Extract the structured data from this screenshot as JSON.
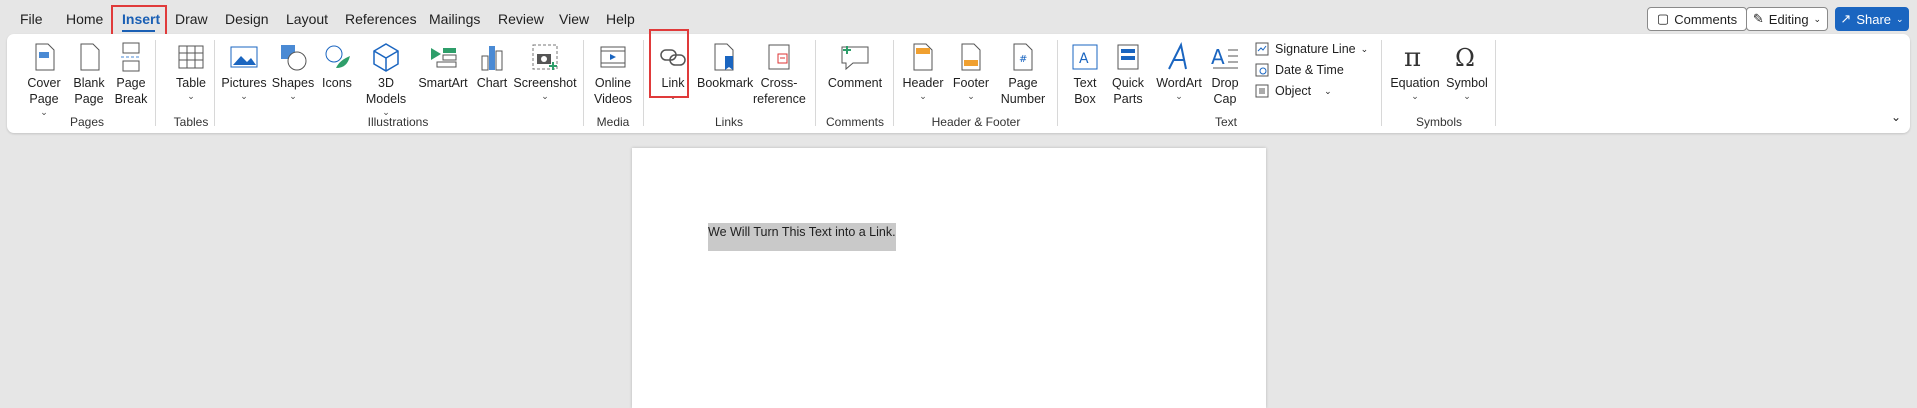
{
  "tabs": [
    {
      "label": "File"
    },
    {
      "label": "Home"
    },
    {
      "label": "Insert",
      "active": true
    },
    {
      "label": "Draw"
    },
    {
      "label": "Design"
    },
    {
      "label": "Layout"
    },
    {
      "label": "References"
    },
    {
      "label": "Mailings"
    },
    {
      "label": "Review"
    },
    {
      "label": "View"
    },
    {
      "label": "Help"
    }
  ],
  "top_right": {
    "comments": "Comments",
    "editing": "Editing",
    "share": "Share"
  },
  "ribbon": {
    "cover_page": "Cover Page",
    "blank_page": "Blank Page",
    "page_break": "Page Break",
    "pages": "Pages",
    "table": "Table",
    "tables": "Tables",
    "pictures": "Pictures",
    "shapes": "Shapes",
    "icons": "Icons",
    "models_3d": "3D Models",
    "smartart": "SmartArt",
    "chart": "Chart",
    "screenshot": "Screenshot",
    "illustrations": "Illustrations",
    "online_videos": "Online Videos",
    "media": "Media",
    "link": "Link",
    "bookmark": "Bookmark",
    "cross_reference": "Cross-reference",
    "links": "Links",
    "comment": "Comment",
    "comments_group": "Comments",
    "header": "Header",
    "footer": "Footer",
    "page_number": "Page Number",
    "header_footer": "Header & Footer",
    "text_box": "Text Box",
    "quick_parts": "Quick Parts",
    "wordart": "WordArt",
    "drop_cap": "Drop Cap",
    "signature_line": "Signature Line",
    "date_time": "Date & Time",
    "object": "Object",
    "text_group": "Text",
    "equation": "Equation",
    "symbol": "Symbol",
    "symbols": "Symbols"
  },
  "document": {
    "selected_text": "We Will Turn This Text into a Link."
  },
  "colors": {
    "accent": "#1a5fb4",
    "highlight": "#e03a3a"
  }
}
